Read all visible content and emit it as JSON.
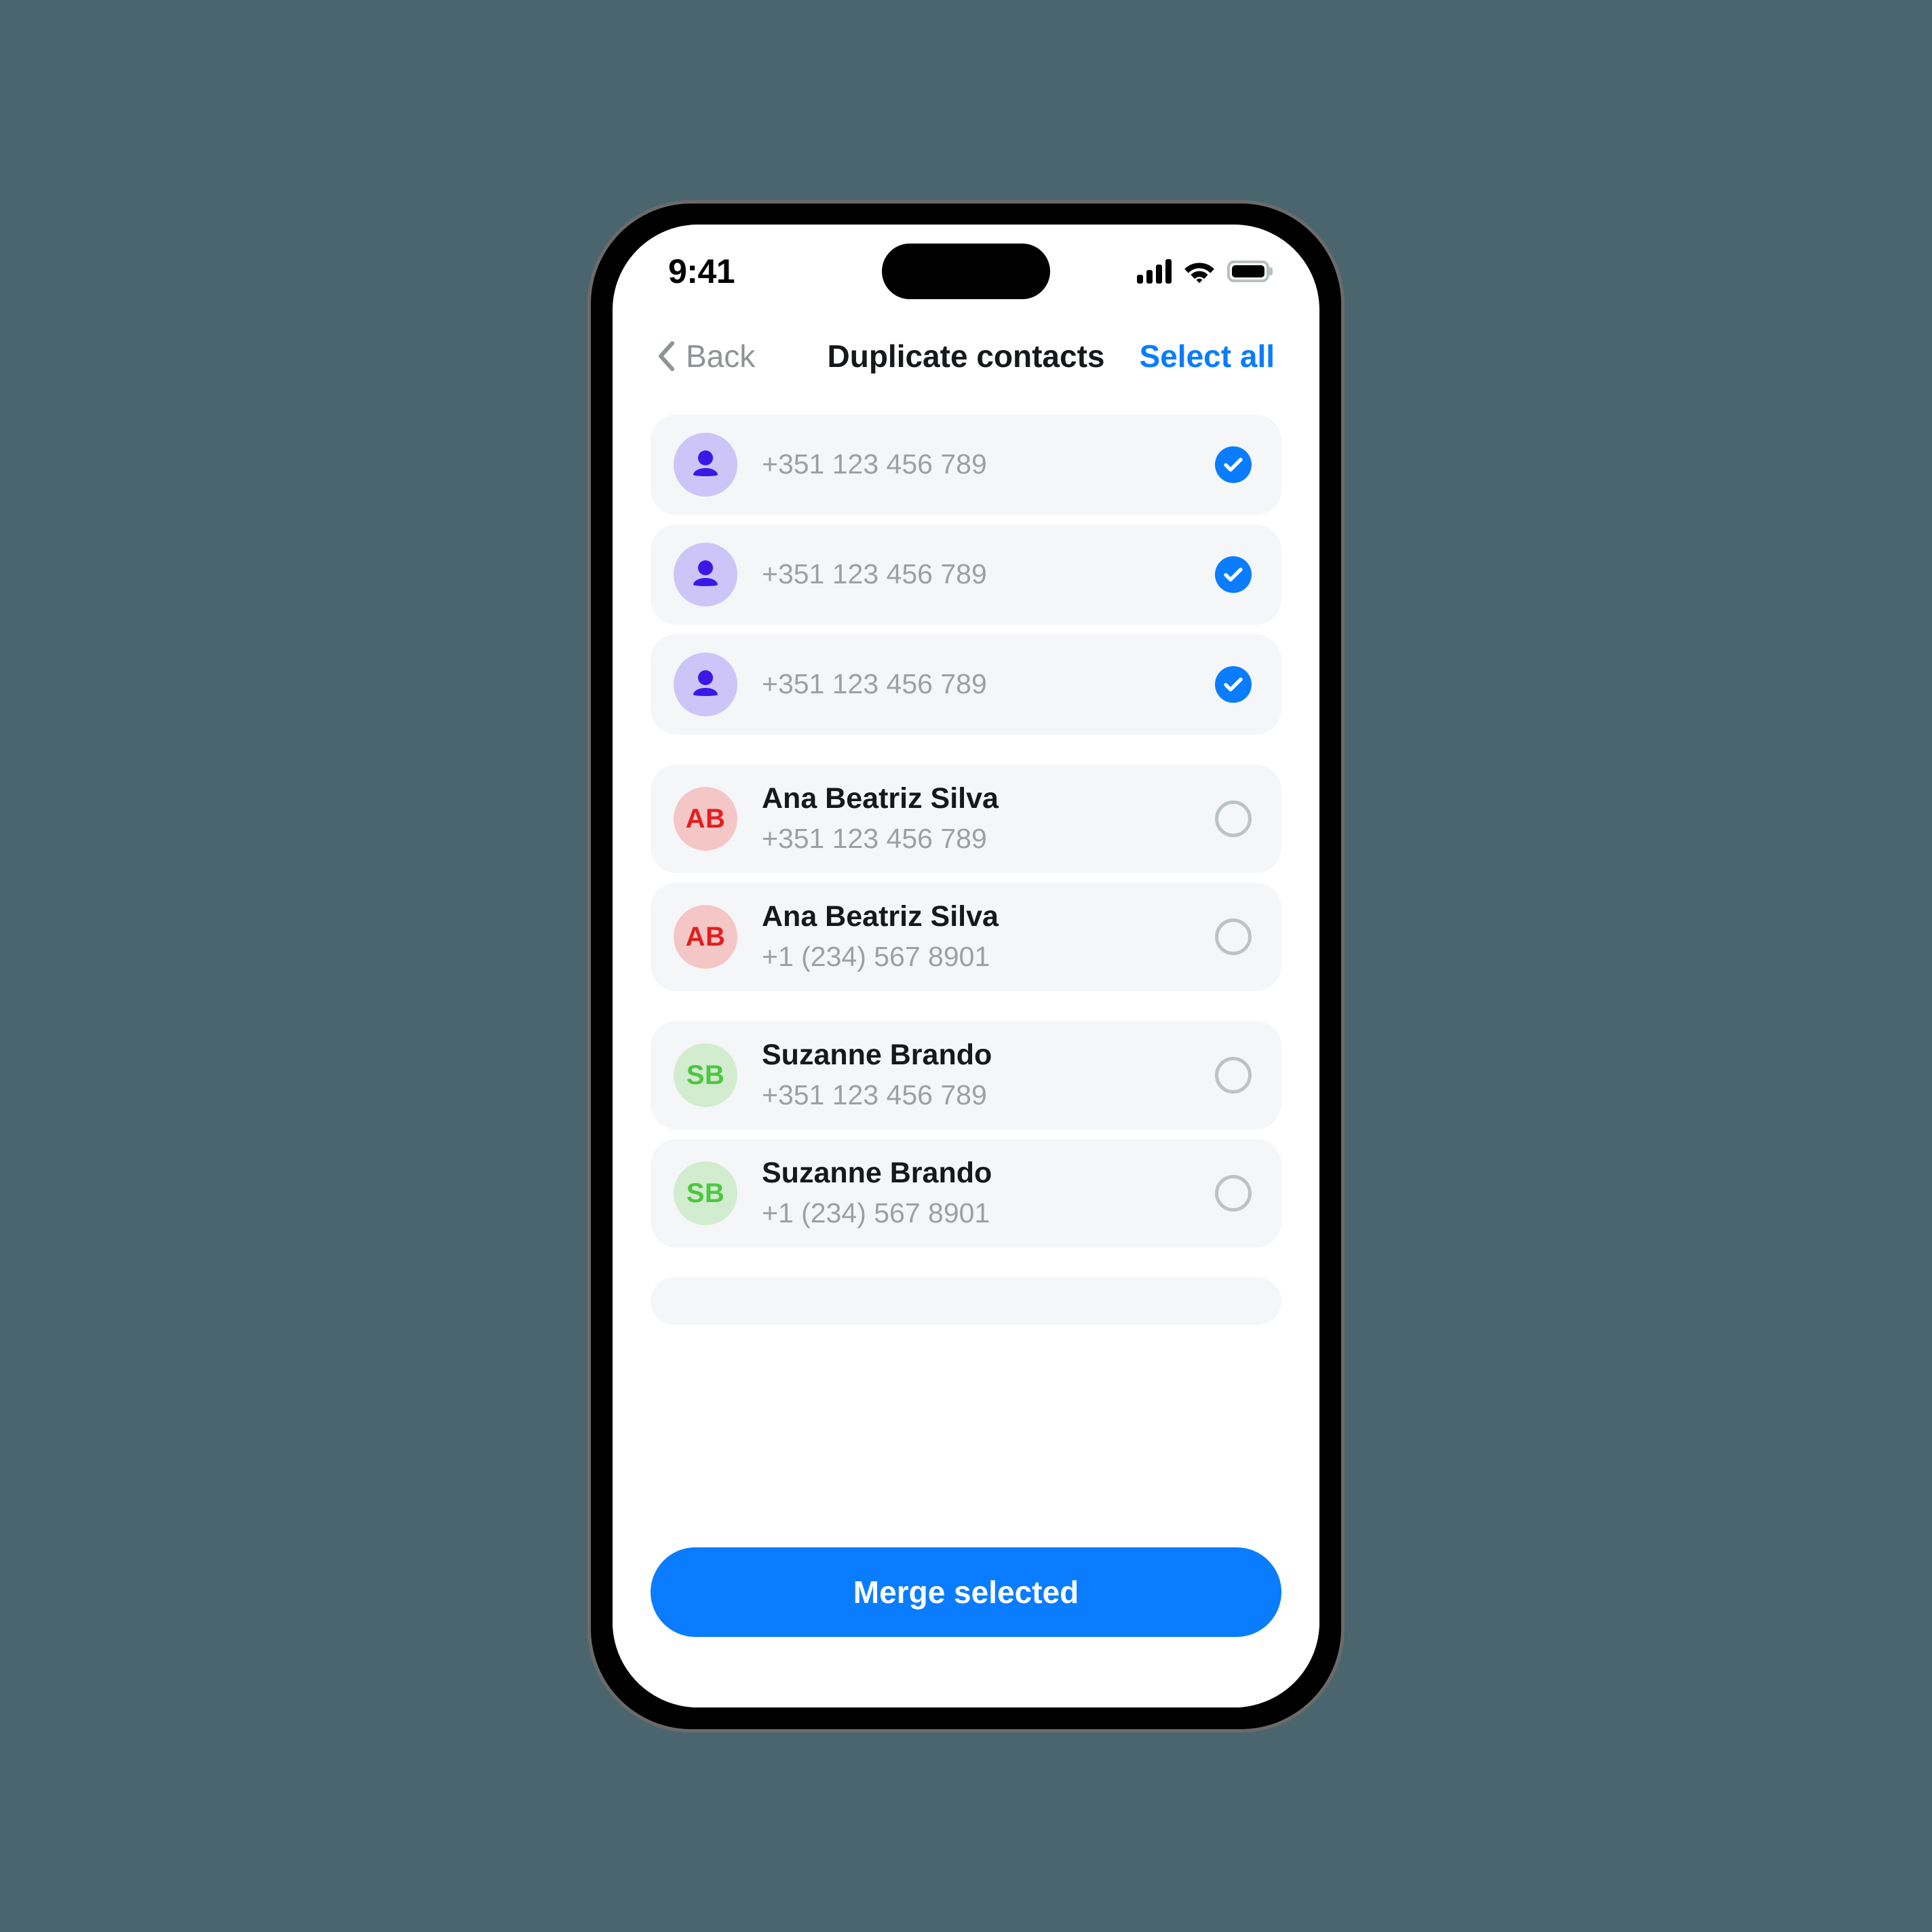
{
  "status_bar": {
    "time": "9:41",
    "signal_icon": "cellular-signal-icon",
    "wifi_icon": "wifi-icon",
    "battery_icon": "battery-full-icon"
  },
  "nav": {
    "back_label": "Back",
    "back_icon": "chevron-left-icon",
    "title": "Duplicate contacts",
    "action_label": "Select all"
  },
  "colors": {
    "accent": "#0a7cff",
    "row_bg": "#f5f6f8",
    "page_bg": "#4a656e",
    "avatar_purple_bg": "#cdc4f7",
    "avatar_purple_fg": "#3b18e8",
    "avatar_red_bg": "#f5c6c6",
    "avatar_red_fg": "#e01f1f",
    "avatar_green_bg": "#d2ecd0",
    "avatar_green_fg": "#4cc73f"
  },
  "groups": [
    {
      "id": "group-phone-only",
      "rows": [
        {
          "avatar_type": "person",
          "initials": "",
          "name": "",
          "phone": "+351 123 456 789",
          "selected": true
        },
        {
          "avatar_type": "person",
          "initials": "",
          "name": "",
          "phone": "+351 123 456 789",
          "selected": true
        },
        {
          "avatar_type": "person",
          "initials": "",
          "name": "",
          "phone": "+351 123 456 789",
          "selected": true
        }
      ]
    },
    {
      "id": "group-ana-beatriz-silva",
      "rows": [
        {
          "avatar_type": "initials-red",
          "initials": "AB",
          "name": "Ana Beatriz Silva",
          "phone": "+351 123 456 789",
          "selected": false
        },
        {
          "avatar_type": "initials-red",
          "initials": "AB",
          "name": "Ana Beatriz Silva",
          "phone": "+1 (234) 567 8901",
          "selected": false
        }
      ]
    },
    {
      "id": "group-suzanne-brando",
      "rows": [
        {
          "avatar_type": "initials-green",
          "initials": "SB",
          "name": "Suzanne Brando",
          "phone": "+351 123 456 789",
          "selected": false
        },
        {
          "avatar_type": "initials-green",
          "initials": "SB",
          "name": "Suzanne Brando",
          "phone": "+1 (234) 567 8901",
          "selected": false
        }
      ]
    }
  ],
  "cta": {
    "label": "Merge selected"
  }
}
